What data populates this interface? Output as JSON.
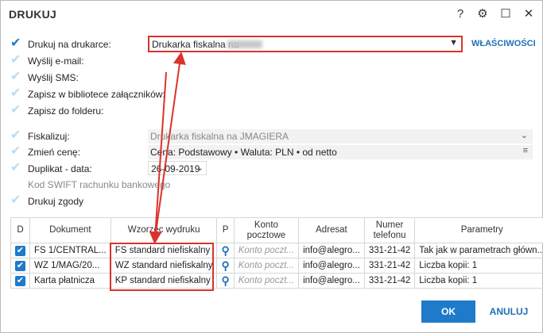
{
  "window": {
    "title": "DRUKUJ",
    "help": "?",
    "settings_icon": "gear-icon",
    "maximize_icon": "square-icon",
    "close_icon": "close-icon"
  },
  "options": [
    {
      "label": "Drukuj na drukarce:",
      "checked": true
    },
    {
      "label": "Wyślij e-mail:",
      "checked": false
    },
    {
      "label": "Wyślij SMS:",
      "checked": false
    },
    {
      "label": "Zapisz w bibliotece załączników:",
      "checked": false
    },
    {
      "label": "Zapisz do folderu:",
      "checked": false
    }
  ],
  "printer": {
    "value": "Drukarka fiskalna na",
    "properties_link": "WŁAŚCIWOŚCI"
  },
  "options2": [
    {
      "label": "Fiskalizuj:",
      "checked": false
    },
    {
      "label": "Zmień cenę:",
      "checked": false
    },
    {
      "label": "Duplikat - data:",
      "checked": false
    },
    {
      "label": "Kod SWIFT rachunku bankowego",
      "checked": false
    },
    {
      "label": "Drukuj zgody",
      "checked": false
    }
  ],
  "fiscal_field": {
    "value": "Drukarka fiskalna na JMAGIERA"
  },
  "price_field": {
    "value": "Cena: Podstawowy • Waluta: PLN • od netto"
  },
  "duplicate_date": {
    "value": "26-09-2019"
  },
  "table": {
    "headers": [
      "D",
      "Dokument",
      "Wzorzec wydruku",
      "P",
      "Konto pocztowe",
      "Adresat",
      "Numer telefonu",
      "Parametry"
    ],
    "rows": [
      {
        "document": "FS 1/CENTRAL...",
        "template": "FS standard niefiskalny",
        "account": "Konto poczt...",
        "recipient": "info@alegro...",
        "phone": "331-21-42",
        "params": "Tak jak w parametrach główn..."
      },
      {
        "document": "WZ 1/MAG/20...",
        "template": "WZ standard niefiskalny",
        "account": "Konto poczt...",
        "recipient": "info@alegro...",
        "phone": "331-21-42",
        "params": "Liczba kopii: 1"
      },
      {
        "document": "Karta płatnicza",
        "template": "KP standard niefiskalny",
        "account": "Konto poczt...",
        "recipient": "info@alegro...",
        "phone": "331-21-42",
        "params": "Liczba kopii: 1"
      }
    ]
  },
  "buttons": {
    "ok": "OK",
    "cancel": "ANULUJ"
  },
  "colors": {
    "accent": "#1f7ac9",
    "highlight": "#d9332b"
  }
}
